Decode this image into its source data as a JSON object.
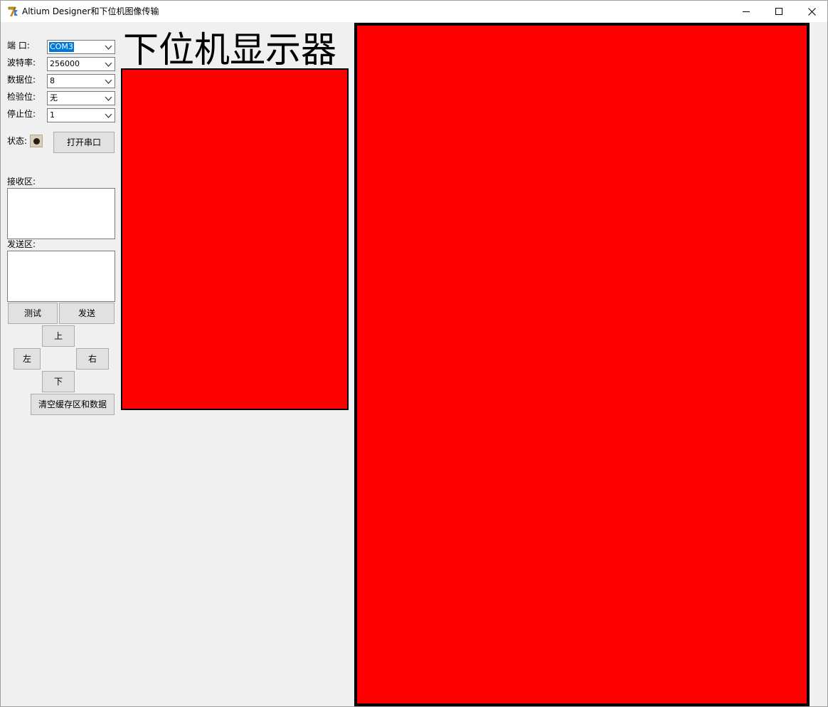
{
  "window": {
    "title": "Altium Designer和下位机图像传输",
    "icons": [
      "app-icon",
      "minimize-icon",
      "maximize-icon",
      "close-icon"
    ]
  },
  "serial": {
    "port_label": "端    口:",
    "port_value": "COM3",
    "baud_label": "波特率:",
    "baud_value": "256000",
    "databits_label": "数据位:",
    "databits_value": "8",
    "parity_label": "检验位:",
    "parity_value": "无",
    "stopbits_label": "停止位:",
    "stopbits_value": "1",
    "status_label": "状态:",
    "open_button": "打开串口"
  },
  "receive": {
    "label": "接收区:",
    "text": ""
  },
  "send": {
    "label": "发送区:",
    "text": ""
  },
  "buttons": {
    "test": "测试",
    "send": "发送",
    "up": "上",
    "left": "左",
    "right": "右",
    "down": "下",
    "clear": "清空缓存区和数据"
  },
  "display": {
    "title": "下位机显示器",
    "screen_color": "#ff0000"
  },
  "colors": {
    "window_bg": "#f0f0f0",
    "selection": "#0078d7",
    "status_led": "#2a1a1a"
  }
}
